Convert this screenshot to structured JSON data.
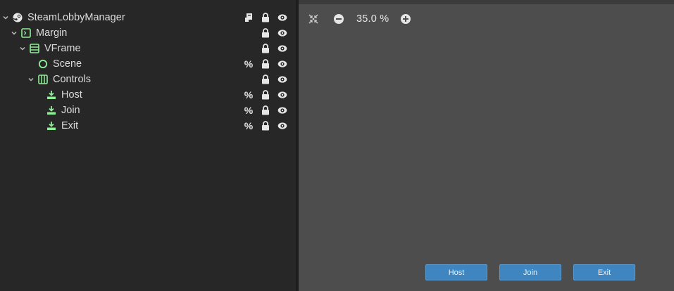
{
  "scene_tree": {
    "nodes": [
      {
        "name": "SteamLobbyManager",
        "icon": "steam-icon",
        "expanded": true,
        "badges": [
          "script-icon",
          "lock-icon",
          "visibility-eye-icon"
        ]
      },
      {
        "name": "Margin",
        "icon": "margin-container-icon",
        "expanded": true,
        "badges": [
          "lock-icon",
          "visibility-eye-icon"
        ]
      },
      {
        "name": "VFrame",
        "icon": "vbox-container-icon",
        "expanded": true,
        "badges": [
          "lock-icon",
          "visibility-eye-icon"
        ]
      },
      {
        "name": "Scene",
        "icon": "control-node-icon",
        "expanded": null,
        "badges": [
          "percent",
          "lock-icon",
          "visibility-eye-icon"
        ]
      },
      {
        "name": "Controls",
        "icon": "hbox-container-icon",
        "expanded": true,
        "badges": [
          "lock-icon",
          "visibility-eye-icon"
        ]
      },
      {
        "name": "Host",
        "icon": "button-node-icon",
        "expanded": null,
        "badges": [
          "percent",
          "lock-icon",
          "visibility-eye-icon"
        ]
      },
      {
        "name": "Join",
        "icon": "button-node-icon",
        "expanded": null,
        "badges": [
          "percent",
          "lock-icon",
          "visibility-eye-icon"
        ]
      },
      {
        "name": "Exit",
        "icon": "button-node-icon",
        "expanded": null,
        "badges": [
          "percent",
          "lock-icon",
          "visibility-eye-icon"
        ]
      }
    ],
    "percent_symbol": "%"
  },
  "viewport": {
    "toolbar": {
      "center_view_icon": "center-view-icon",
      "zoom_out_icon": "zoom-out-icon",
      "zoom_level": "35.0 %",
      "zoom_in_icon": "zoom-in-icon"
    },
    "preview_buttons": {
      "host_label": "Host",
      "join_label": "Join",
      "exit_label": "Exit"
    }
  },
  "colors": {
    "node_icon_green": "#8eef97",
    "button_blue": "#3f86c1",
    "viewport_bg": "#4d4d4d",
    "panel_bg": "#272727"
  }
}
